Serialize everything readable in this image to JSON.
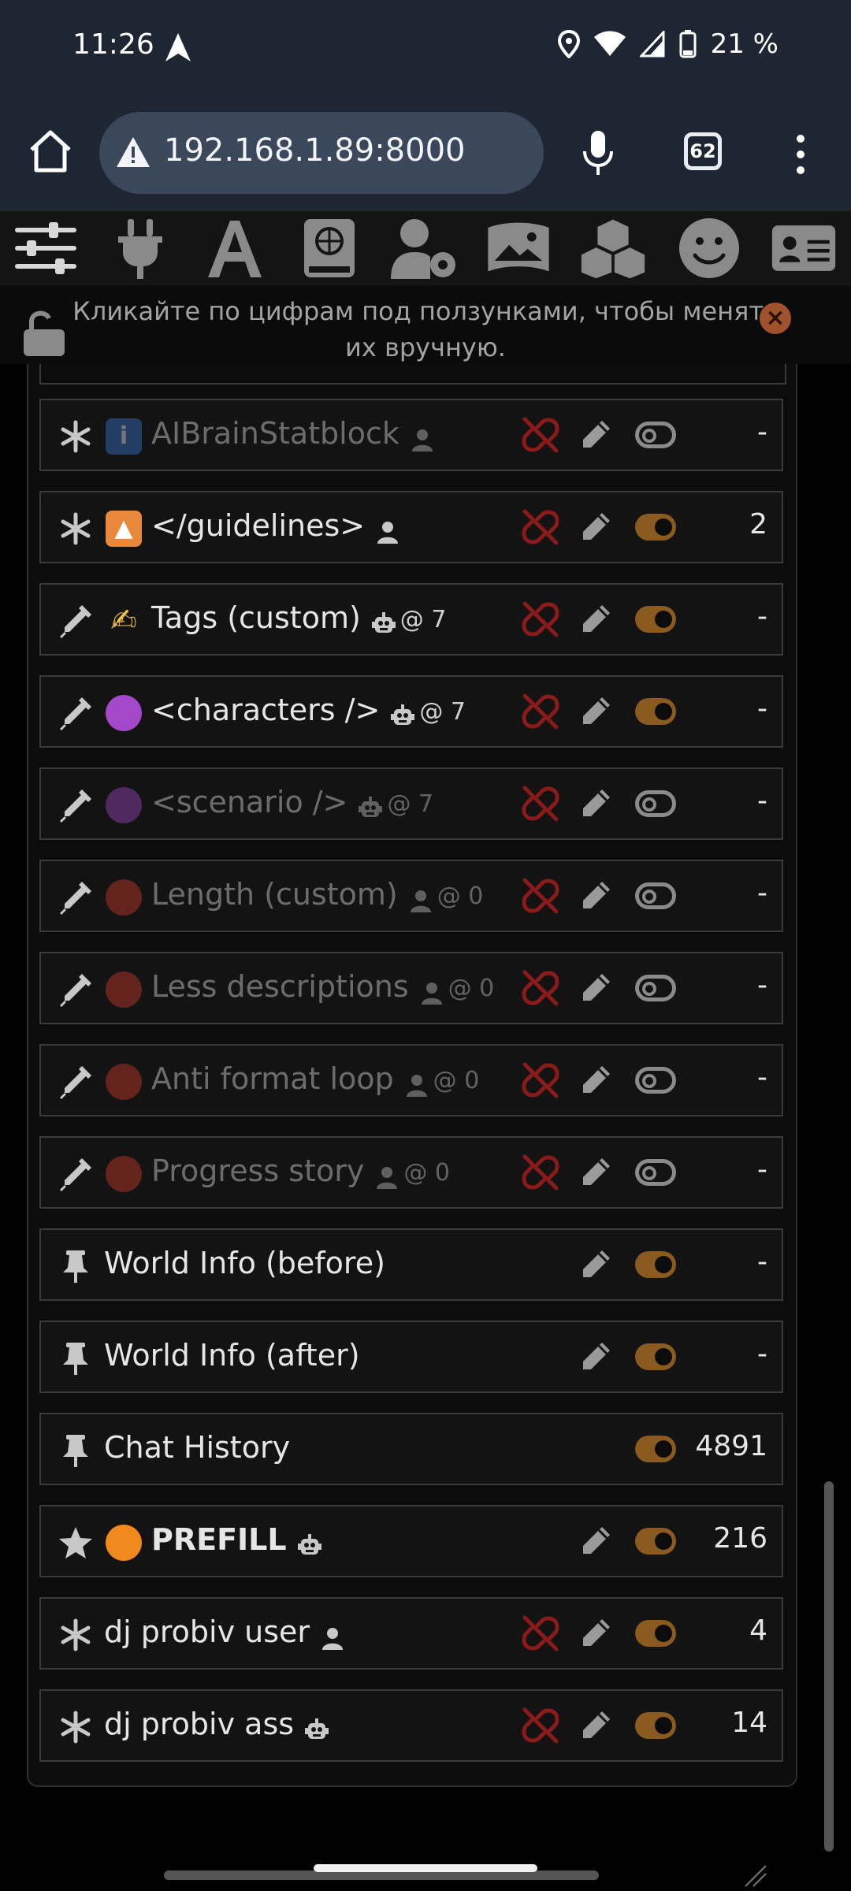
{
  "status_bar": {
    "time": "11:26",
    "battery": "21 %"
  },
  "browser": {
    "url": "192.168.1.89:8000",
    "tab_count": "62"
  },
  "toolbar_icons": [
    "sliders-icon",
    "plug-icon",
    "font-icon",
    "book-globe-icon",
    "user-gear-icon",
    "image-icon",
    "cubes-icon",
    "smile-icon",
    "id-card-icon"
  ],
  "notice": {
    "text": "Кликайте по цифрам под ползунками, чтобы менять их вручную."
  },
  "rows": [
    {
      "type_icon": "asterisk-icon",
      "emoji": "ℹ️",
      "label": "AIBrainStatblock",
      "role": "user-icon",
      "depth": "",
      "enabled": false,
      "has_unlink": true,
      "has_pencil": true,
      "tokens": "-"
    },
    {
      "type_icon": "asterisk-icon",
      "emoji": "🔼",
      "label": "</guidelines>",
      "role": "user-icon",
      "depth": "",
      "enabled": true,
      "has_unlink": true,
      "has_pencil": true,
      "tokens": "2"
    },
    {
      "type_icon": "syringe-icon",
      "emoji": "✍️",
      "label": "Tags (custom)",
      "role": "robot-icon",
      "depth": "@ 7",
      "enabled": true,
      "has_unlink": true,
      "has_pencil": true,
      "tokens": "-"
    },
    {
      "type_icon": "syringe-icon",
      "emoji": "🟣",
      "label": "<characters />",
      "role": "robot-icon",
      "depth": "@ 7",
      "enabled": true,
      "has_unlink": true,
      "has_pencil": true,
      "tokens": "-"
    },
    {
      "type_icon": "syringe-icon",
      "emoji": "🟣",
      "label": "<scenario />",
      "role": "robot-icon",
      "depth": "@ 7",
      "enabled": false,
      "has_unlink": true,
      "has_pencil": true,
      "tokens": "-"
    },
    {
      "type_icon": "syringe-icon",
      "emoji": "🔴",
      "label": "Length (custom)",
      "role": "user-icon",
      "depth": "@ 0",
      "enabled": false,
      "has_unlink": true,
      "has_pencil": true,
      "tokens": "-"
    },
    {
      "type_icon": "syringe-icon",
      "emoji": "🔴",
      "label": "Less descriptions",
      "role": "user-icon",
      "depth": "@ 0",
      "enabled": false,
      "has_unlink": true,
      "has_pencil": true,
      "tokens": "-"
    },
    {
      "type_icon": "syringe-icon",
      "emoji": "🔴",
      "label": "Anti format loop",
      "role": "user-icon",
      "depth": "@ 0",
      "enabled": false,
      "has_unlink": true,
      "has_pencil": true,
      "tokens": "-"
    },
    {
      "type_icon": "syringe-icon",
      "emoji": "🔴",
      "label": "Progress story",
      "role": "user-icon",
      "depth": "@ 0",
      "enabled": false,
      "has_unlink": true,
      "has_pencil": true,
      "tokens": "-"
    },
    {
      "type_icon": "pin-icon",
      "emoji": "",
      "label": "World Info (before)",
      "role": "",
      "depth": "",
      "enabled": true,
      "has_unlink": false,
      "has_pencil": true,
      "tokens": "-"
    },
    {
      "type_icon": "pin-icon",
      "emoji": "",
      "label": "World Info (after)",
      "role": "",
      "depth": "",
      "enabled": true,
      "has_unlink": false,
      "has_pencil": true,
      "tokens": "-"
    },
    {
      "type_icon": "pin-icon",
      "emoji": "",
      "label": "Chat History",
      "role": "",
      "depth": "",
      "enabled": true,
      "has_unlink": false,
      "has_pencil": false,
      "tokens": "4891"
    },
    {
      "type_icon": "star-icon",
      "emoji": "🟠",
      "label": "PREFILL",
      "role": "robot-icon",
      "depth": "",
      "enabled": true,
      "has_unlink": false,
      "has_pencil": true,
      "tokens": "216",
      "bold": true
    },
    {
      "type_icon": "asterisk-icon",
      "emoji": "",
      "label": "dj probiv user",
      "role": "user-icon",
      "depth": "",
      "enabled": true,
      "has_unlink": true,
      "has_pencil": true,
      "tokens": "4"
    },
    {
      "type_icon": "asterisk-icon",
      "emoji": "",
      "label": "dj probiv ass",
      "role": "robot-icon",
      "depth": "",
      "enabled": true,
      "has_unlink": true,
      "has_pencil": true,
      "tokens": "14"
    }
  ],
  "colors": {
    "toggle_on": "#8b5a1f",
    "unlink": "#8b1a1a",
    "notice_close": "#a0522d"
  }
}
